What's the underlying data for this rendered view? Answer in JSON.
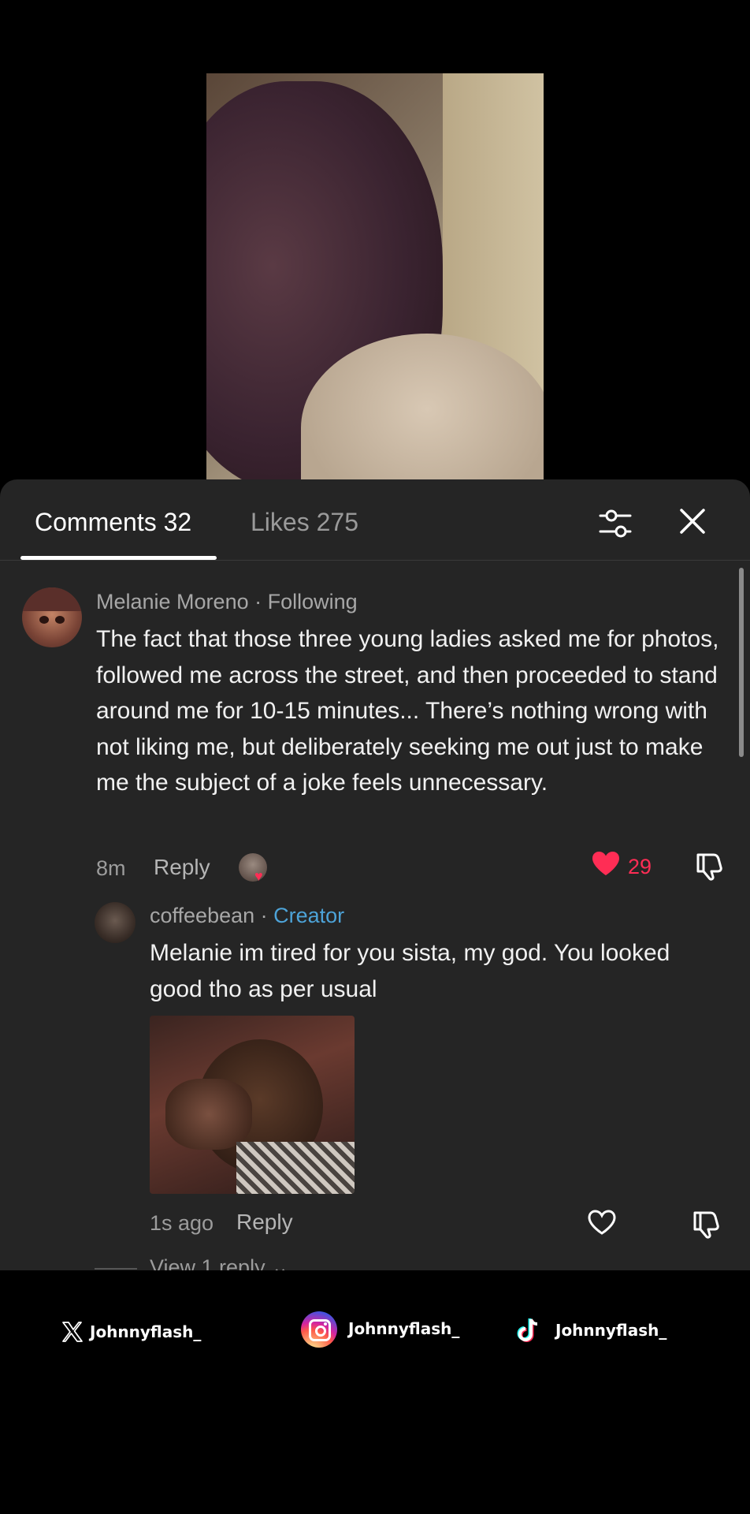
{
  "tabs": {
    "comments": "Comments 32",
    "likes": "Likes 275"
  },
  "comment1": {
    "author": "Melanie Moreno",
    "separator": " · ",
    "relation": "Following",
    "text": "The fact that those three young ladies asked me for photos, followed me across the street, and then proceeded to stand around me for 10-15 minutes... There’s nothing wrong with not liking me, but deliberately seeking me out just to make me the subject of a joke feels unnecessary.",
    "time": "8m",
    "reply_label": "Reply",
    "like_count": "29"
  },
  "comment2": {
    "author": "coffeebean",
    "separator": " · ",
    "badge": "Creator",
    "text": "Melanie im tired for you sista, my god. You looked good tho as per usual",
    "time": "1s ago",
    "reply_label": "Reply",
    "view_replies": "View 1 reply"
  },
  "footer": {
    "x_handle": "Johnnyflash_",
    "instagram_handle": "Johnnyflash_",
    "tiktok_handle": "Johnnyflash_"
  },
  "colors": {
    "accent_like": "#ff2d55",
    "creator_badge": "#4da3d8",
    "sheet_bg": "#252525"
  }
}
